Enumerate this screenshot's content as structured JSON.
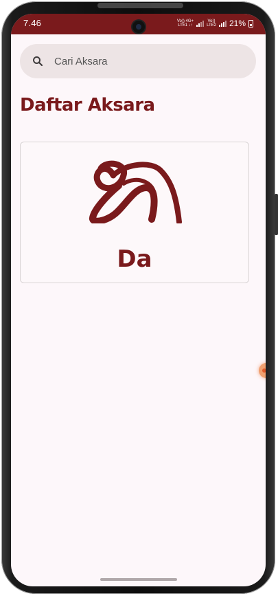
{
  "status_bar": {
    "time": "7.46",
    "network_1": "Vo)) 4G+\nLTE1 ↓↑",
    "network_2": "Vo))\nLTE2",
    "battery_percent": "21%",
    "background_color": "#7a1a1c"
  },
  "search": {
    "placeholder": "Cari Aksara",
    "value": "",
    "icon": "search-icon"
  },
  "section": {
    "title": "Daftar Aksara"
  },
  "aksara_list": [
    {
      "label": "Da",
      "glyph_icon": "balinese-aksara-da-glyph"
    }
  ],
  "theme": {
    "accent": "#7a1a1c",
    "background": "#fdf7fa",
    "search_background": "#ede4e5"
  }
}
